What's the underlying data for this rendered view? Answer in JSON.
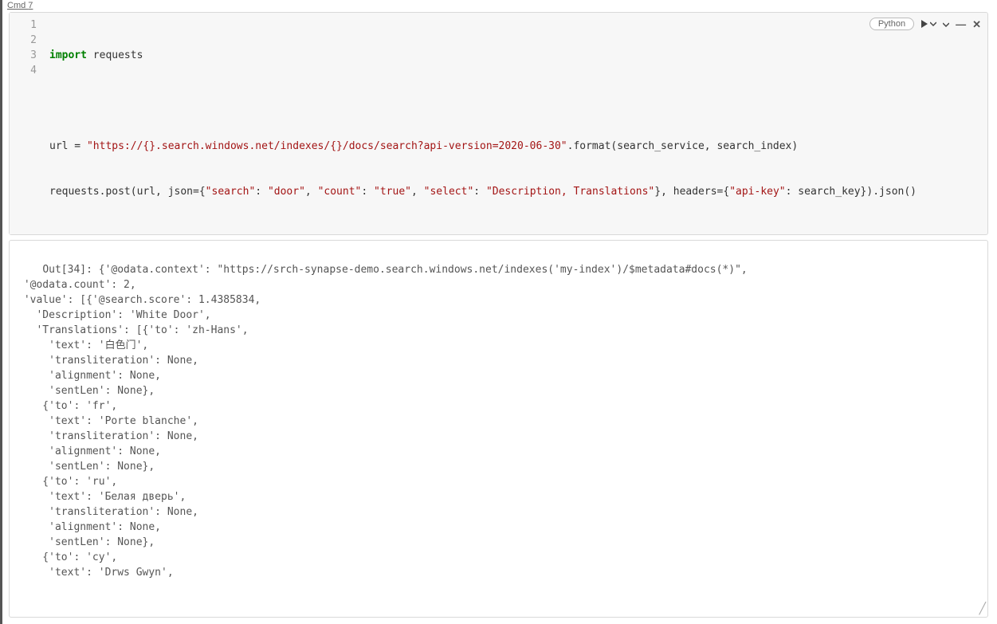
{
  "cell": {
    "label_prefix": "Cmd ",
    "label_num": "7"
  },
  "toolbar": {
    "language": "Python"
  },
  "code": {
    "line_numbers": [
      "1",
      "2",
      "3",
      "4"
    ],
    "l1_kw": "import",
    "l1_mod": " requests",
    "l3_a": "url = ",
    "l3_str": "\"https://{}.search.windows.net/indexes/{}/docs/search?api-version=2020-06-30\"",
    "l3_b": ".format(search_service, search_index)",
    "l4_a": "requests.post(url, json={",
    "l4_k1": "\"search\"",
    "l4_c1": ": ",
    "l4_v1": "\"door\"",
    "l4_c2": ", ",
    "l4_k2": "\"count\"",
    "l4_c3": ": ",
    "l4_v2": "\"true\"",
    "l4_c4": ", ",
    "l4_k3": "\"select\"",
    "l4_c5": ": ",
    "l4_v3": "\"Description, Translations\"",
    "l4_c6": "}, headers={",
    "l4_k4": "\"api-key\"",
    "l4_c7": ": search_key}).json()"
  },
  "output_text": "Out[34]: {'@odata.context': \"https://srch-synapse-demo.search.windows.net/indexes('my-index')/$metadata#docs(*)\",\n '@odata.count': 2,\n 'value': [{'@search.score': 1.4385834,\n   'Description': 'White Door',\n   'Translations': [{'to': 'zh-Hans',\n     'text': '白色门',\n     'transliteration': None,\n     'alignment': None,\n     'sentLen': None},\n    {'to': 'fr',\n     'text': 'Porte blanche',\n     'transliteration': None,\n     'alignment': None,\n     'sentLen': None},\n    {'to': 'ru',\n     'text': 'Белая дверь',\n     'transliteration': None,\n     'alignment': None,\n     'sentLen': None},\n    {'to': 'cy',\n     'text': 'Drws Gwyn',"
}
